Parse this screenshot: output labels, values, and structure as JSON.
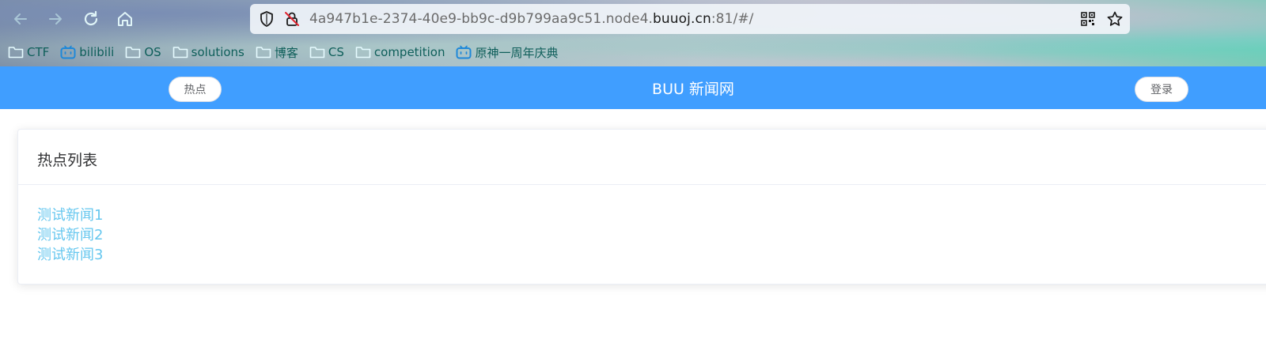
{
  "browser": {
    "url_prefix": "4a947b1e-2374-40e9-bb9c-d9b799aa9c51.node4.",
    "url_domain": "buuoj.cn",
    "url_suffix": ":81/#/",
    "bookmarks": [
      {
        "label": "CTF",
        "icon": "folder-icon"
      },
      {
        "label": "bilibili",
        "icon": "bilibili-icon"
      },
      {
        "label": "OS",
        "icon": "folder-icon"
      },
      {
        "label": "solutions",
        "icon": "folder-icon"
      },
      {
        "label": "博客",
        "icon": "folder-icon"
      },
      {
        "label": "CS",
        "icon": "folder-icon"
      },
      {
        "label": "competition",
        "icon": "folder-icon"
      },
      {
        "label": "原神一周年庆典",
        "icon": "bilibili-icon"
      }
    ]
  },
  "header": {
    "hot_button": "热点",
    "title": "BUU 新闻网",
    "login_button": "登录",
    "bg_color": "#409eff"
  },
  "card": {
    "title": "热点列表",
    "news": [
      {
        "title": "测试新闻1"
      },
      {
        "title": "测试新闻2"
      },
      {
        "title": "测试新闻3"
      }
    ],
    "link_color": "#66c7ef"
  }
}
